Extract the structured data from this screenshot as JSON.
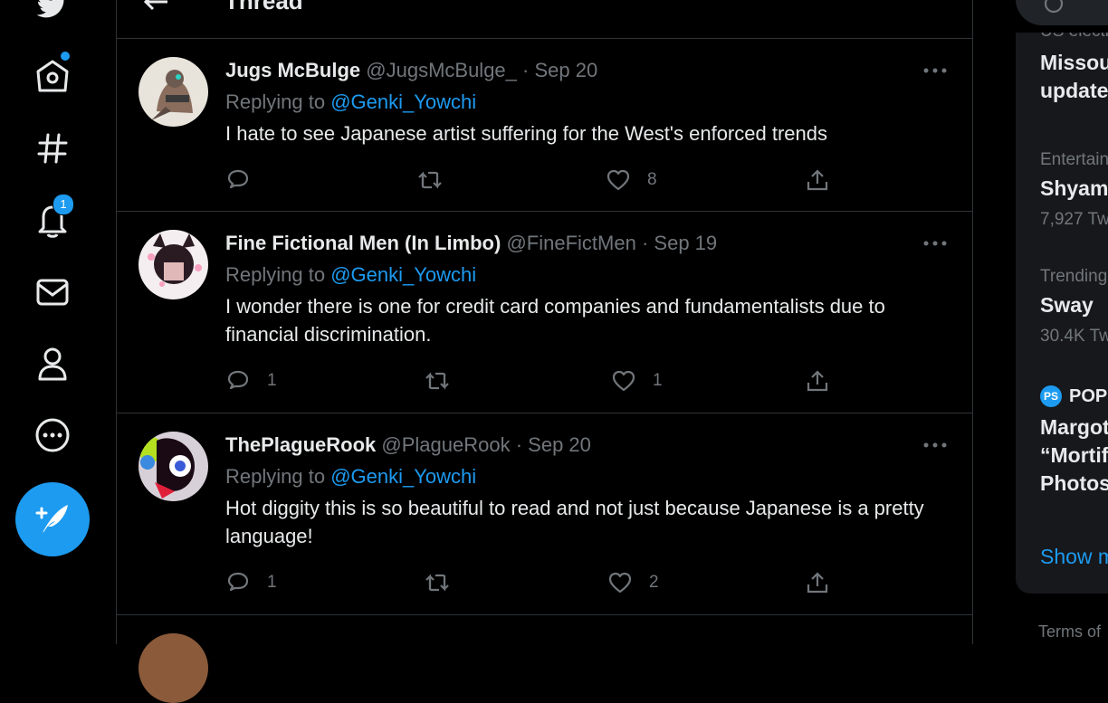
{
  "colors": {
    "accent": "#1d9bf0",
    "background": "#000000",
    "text": "#e7e9ea",
    "muted": "#71767b",
    "border": "#2f3336"
  },
  "nav": {
    "notification_count": "1",
    "icons": [
      "twitter-logo-icon",
      "home-icon",
      "explore-hashtag-icon",
      "notifications-bell-icon",
      "messages-envelope-icon",
      "profile-icon",
      "more-circle-icon",
      "compose-tweet-icon"
    ]
  },
  "header": {
    "title": "Thread"
  },
  "tweets": [
    {
      "name": "Jugs McBulge",
      "handle": "@JugsMcBulge_",
      "separator": "·",
      "date": "Sep 20",
      "replying_prefix": "Replying to",
      "replying_to": "@Genki_Yowchi",
      "text": "I hate to see Japanese artist suffering for the West's enforced trends",
      "replies": "",
      "retweets": "",
      "likes": "8"
    },
    {
      "name": "Fine Fictional Men (In Limbo)",
      "handle": "@FineFictMen",
      "separator": "·",
      "date": "Sep 19",
      "replying_prefix": "Replying to",
      "replying_to": "@Genki_Yowchi",
      "text": "I wonder there is one for credit card companies and fundamentalists due to financial discrimination.",
      "replies": "1",
      "retweets": "",
      "likes": "1"
    },
    {
      "name": "ThePlagueRook",
      "handle": "@PlagueRook",
      "separator": "·",
      "date": "Sep 20",
      "replying_prefix": "Replying to",
      "replying_to": "@Genki_Yowchi",
      "text": "Hot diggity this is so beautiful to read and not just because Japanese is a pretty language!",
      "replies": "1",
      "retweets": "",
      "likes": "2"
    }
  ],
  "sidebar": {
    "trends": [
      {
        "meta": "US electi",
        "title_line1": "Missou",
        "title_line2": "update"
      },
      {
        "meta": "Entertain",
        "title": "Shyam",
        "count": "7,927 Tw"
      },
      {
        "meta": "Trending",
        "title": "Sway",
        "count": "30.4K Tw"
      },
      {
        "source_badge": "PS",
        "source": "POPS",
        "title_line1": "Margot",
        "title_line2": "“Mortif",
        "title_line3": "Photos"
      }
    ],
    "show_more": "Show m",
    "terms": "Terms of"
  }
}
